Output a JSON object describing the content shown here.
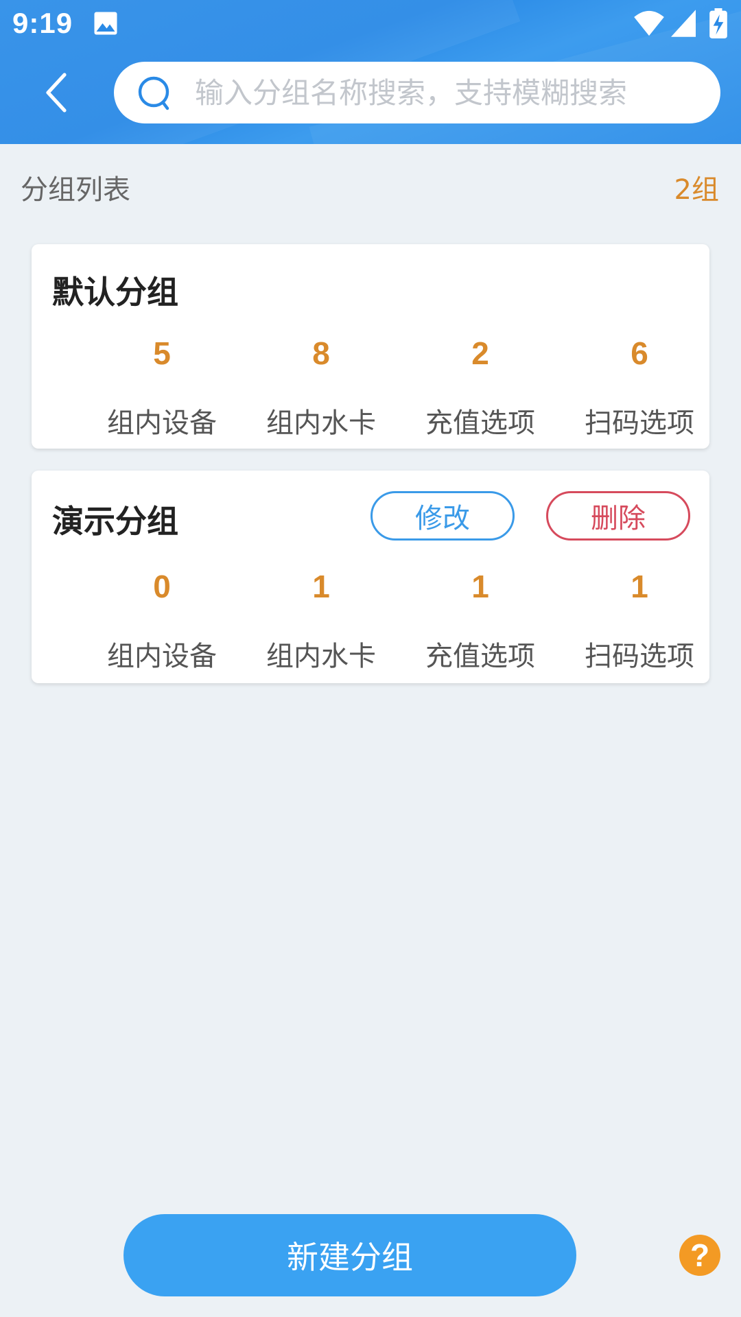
{
  "status_bar": {
    "time": "9:19"
  },
  "header": {
    "search": {
      "placeholder": "输入分组名称搜索，支持模糊搜索",
      "value": ""
    }
  },
  "list": {
    "title": "分组列表",
    "count": "2组"
  },
  "groups": [
    {
      "name": "默认分组",
      "stats": [
        {
          "value": "5",
          "label": "组内设备"
        },
        {
          "value": "8",
          "label": "组内水卡"
        },
        {
          "value": "2",
          "label": "充值选项"
        },
        {
          "value": "6",
          "label": "扫码选项"
        }
      ]
    },
    {
      "name": "演示分组",
      "edit_label": "修改",
      "delete_label": "删除",
      "stats": [
        {
          "value": "0",
          "label": "组内设备"
        },
        {
          "value": "1",
          "label": "组内水卡"
        },
        {
          "value": "1",
          "label": "充值选项"
        },
        {
          "value": "1",
          "label": "扫码选项"
        }
      ]
    }
  ],
  "footer": {
    "new_group_label": "新建分组",
    "help_label": "?"
  },
  "colors": {
    "primary": "#3aa2f2",
    "accent": "#d98a2b",
    "danger": "#d64a5c",
    "help": "#f39a24"
  },
  "icons": [
    "image-icon",
    "wifi-icon",
    "signal-icon",
    "battery-icon",
    "back-arrow-icon",
    "search-icon"
  ]
}
